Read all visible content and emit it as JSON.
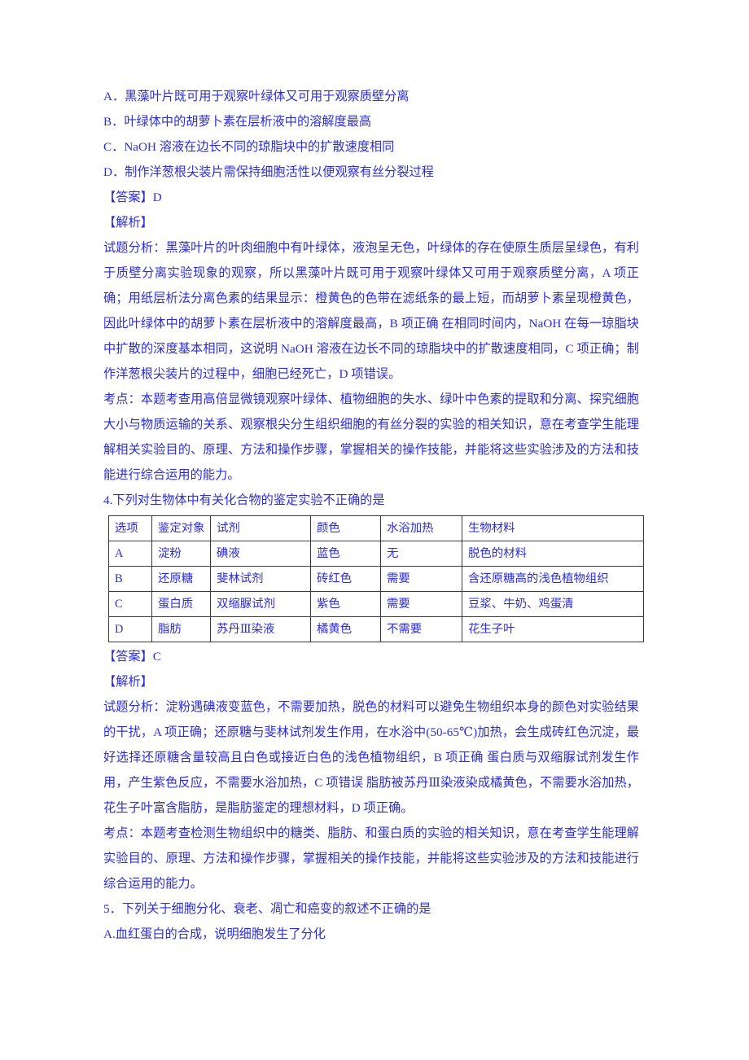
{
  "document": {
    "text_color": "#2d2dd6",
    "table_border_color": "#3a3a3a",
    "background": "#ffffff"
  },
  "question3": {
    "options": [
      {
        "label": "A．",
        "text": "黑藻叶片既可用于观察叶绿体又可用于观察质壁分离"
      },
      {
        "label": "B．",
        "text": "叶绿体中的胡萝卜素在层析液中的溶解度最高"
      },
      {
        "label": "C．",
        "text": "NaOH 溶液在边长不同的琼脂块中的扩散速度相同"
      },
      {
        "label": "D．",
        "text": "制作洋葱根尖装片需保持细胞活性以便观察有丝分裂过程"
      }
    ],
    "answer_label": "【答案】",
    "answer_value": "D",
    "analysis_label": "【解析】",
    "analysis_paragraph": "试题分析：黑藻叶片的叶肉细胞中有叶绿体，液泡呈无色，叶绿体的存在使原生质层呈绿色，有利于质壁分离实验现象的观察，所以黑藻叶片既可用于观察叶绿体又可用于观察质壁分离，A 项正确；用纸层析法分离色素的结果显示：橙黄色的色带在滤纸条的最上短，而胡萝卜素呈现橙黄色，因此叶绿体中的胡萝卜素在层析液中的溶解度最高，B 项正确 在相同时间内，NaOH 在每一琼脂块中扩散的深度基本相同，这说明 NaOH 溶液在边长不同的琼脂块中的扩散速度相同，C 项正确；制作洋葱根尖装片的过程中，细胞已经死亡，D 项错误。",
    "kaodian_paragraph": "考点：本题考查用高倍显微镜观察叶绿体、植物细胞的失水、绿叶中色素的提取和分离、探究细胞大小与物质运输的关系、观察根尖分生组织细胞的有丝分裂的实验的相关知识，意在考查学生能理解相关实验目的、原理、方法和操作步骤，掌握相关的操作技能，并能将这些实验涉及的方法和技能进行综合运用的能力。"
  },
  "question4": {
    "stem": "4.下列对生物体中有关化合物的鉴定实验不正确的是",
    "table": {
      "headers": [
        "选项",
        "鉴定对象",
        "试剂",
        "颜色",
        "水浴加热",
        "生物材料"
      ],
      "rows": [
        [
          "A",
          "淀粉",
          "碘液",
          "蓝色",
          "无",
          "脱色的材料"
        ],
        [
          "B",
          "还原糖",
          "斐林试剂",
          "砖红色",
          "需要",
          "含还原糖高的浅色植物组织"
        ],
        [
          "C",
          "蛋白质",
          "双缩脲试剂",
          "紫色",
          "需要",
          "豆浆、牛奶、鸡蛋清"
        ],
        [
          "D",
          "脂肪",
          "苏丹Ⅲ染液",
          "橘黄色",
          "不需要",
          "花生子叶"
        ]
      ]
    },
    "answer_label": "【答案】",
    "answer_value": "C",
    "analysis_label": "【解析】",
    "analysis_paragraph": "试题分析：淀粉遇碘液变蓝色，不需要加热，脱色的材料可以避免生物组织本身的颜色对实验结果的干扰，A 项正确；还原糖与斐林试剂发生作用，在水浴中(50-65℃)加热，会生成砖红色沉淀，最好选择还原糖含量较高且白色或接近白色的浅色植物组织，B 项正确 蛋白质与双缩脲试剂发生作用，产生紫色反应，不需要水浴加热，C 项错误 脂肪被苏丹Ⅲ染液染成橘黄色，不需要水浴加热，花生子叶富含脂肪，是脂肪鉴定的理想材料，D 项正确。",
    "kaodian_paragraph": "考点：本题考查检测生物组织中的糖类、脂肪、和蛋白质的实验的相关知识，意在考查学生能理解实验目的、原理、方法和操作步骤，掌握相关的操作技能，并能将这些实验涉及的方法和技能进行综合运用的能力。"
  },
  "question5": {
    "stem": "5．下列关于细胞分化、衰老、凋亡和癌变的叙述不正确的是",
    "options": [
      {
        "label": "A.",
        "text": "血红蛋白的合成，说明细胞发生了分化"
      }
    ]
  }
}
